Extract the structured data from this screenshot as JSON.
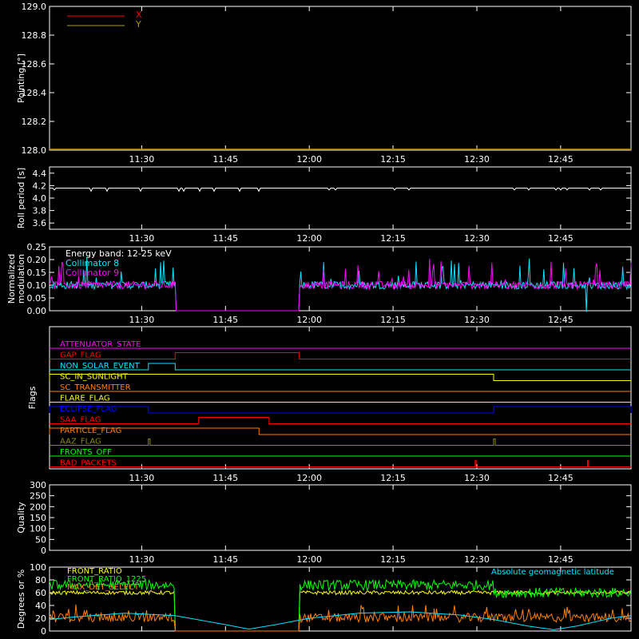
{
  "time_axis": {
    "ticks": [
      "11:30",
      "11:45",
      "12:00",
      "12:15",
      "12:30",
      "12:45"
    ],
    "tick_hours": [
      11.5,
      11.75,
      12.0,
      12.25,
      12.5,
      12.75
    ],
    "range": [
      11.225,
      12.96
    ]
  },
  "chart_data": [
    {
      "type": "line",
      "panel": "pointing",
      "ylabel": "Pointing [°]",
      "ylim": [
        128.0,
        129.0
      ],
      "yticks": [
        "128.0",
        "128.2",
        "128.4",
        "128.6",
        "128.8",
        "129.0"
      ],
      "yticks_val": [
        128.0,
        128.2,
        128.4,
        128.6,
        128.8,
        129.0
      ],
      "legend_position": "top-left",
      "series": [
        {
          "name": "X",
          "color": "#ff0000",
          "x": [
            11.225,
            12.96
          ],
          "y": [
            128.0,
            128.0
          ]
        },
        {
          "name": "Y",
          "color": "#b09a00",
          "x": [
            11.225,
            12.96
          ],
          "y": [
            128.0,
            128.0
          ]
        }
      ]
    },
    {
      "type": "line",
      "panel": "roll",
      "ylabel": "Roll period [s]",
      "ylim": [
        3.5,
        4.5
      ],
      "yticks": [
        "3.6",
        "3.8",
        "4.0",
        "4.2",
        "4.4"
      ],
      "yticks_val": [
        3.6,
        3.8,
        4.0,
        4.2,
        4.4
      ],
      "series": [
        {
          "name": "Roll period",
          "color": "#ffffff",
          "x": [
            11.225,
            12.96
          ],
          "y": [
            4.16,
            4.16
          ]
        }
      ]
    },
    {
      "type": "line",
      "panel": "modulation",
      "ylabel": "Normalized modulation",
      "ylabel_lines": [
        "Normalized",
        "modulation"
      ],
      "ylim": [
        0.0,
        0.25
      ],
      "yticks": [
        "0.00",
        "0.05",
        "0.10",
        "0.15",
        "0.20",
        "0.25"
      ],
      "yticks_val": [
        0.0,
        0.05,
        0.1,
        0.15,
        0.2,
        0.25
      ],
      "legend_position": "top-left",
      "legend_title": "Energy band: 12-25 keV",
      "gap": [
        11.6,
        11.97
      ],
      "series": [
        {
          "name": "Collimator 8",
          "color": "#00e5ff",
          "baseline": 0.1
        },
        {
          "name": "Collimator 9",
          "color": "#ff00ff",
          "baseline": 0.1
        }
      ]
    },
    {
      "type": "line",
      "panel": "flags",
      "ylabel": "Flags",
      "flags": [
        {
          "name": "ATTENUATOR_STATE",
          "color": "#ff00ff",
          "high": []
        },
        {
          "name": "GAP_FLAG",
          "color": "#ff0000",
          "high": [
            [
              11.6,
              11.97
            ]
          ]
        },
        {
          "name": "NON_SOLAR_EVENT",
          "color": "#00e5ff",
          "high": [
            [
              11.52,
              11.6
            ]
          ]
        },
        {
          "name": "SC_IN_SUNLIGHT",
          "color": "#ffff00",
          "high": [
            [
              11.225,
              12.55
            ]
          ]
        },
        {
          "name": "SC_TRANSMITTER",
          "color": "#ff8000",
          "high": []
        },
        {
          "name": "FLARE_FLAG",
          "color": "#ffff00",
          "high": []
        },
        {
          "name": "ECLIPSE_FLAG",
          "color": "#0000ff",
          "high": [
            [
              11.225,
              11.52
            ],
            [
              12.55,
              12.96
            ]
          ]
        },
        {
          "name": "SAA_FLAG",
          "color": "#ff0000",
          "high": [
            [
              11.67,
              11.88
            ]
          ]
        },
        {
          "name": "PARTICLE_FLAG",
          "color": "#ff8000",
          "high": [
            [
              11.225,
              11.85
            ]
          ]
        },
        {
          "name": "AAZ_FLAG",
          "color": "#8a8a00",
          "high": [
            [
              11.52,
              11.525
            ],
            [
              12.55,
              12.555
            ]
          ]
        },
        {
          "name": "FRONTS_OFF",
          "color": "#00ff00",
          "high": []
        },
        {
          "name": "BAD_PACKETS",
          "color": "#ff0000",
          "high": [
            [
              12.495,
              12.498
            ],
            [
              12.83,
              12.833
            ]
          ]
        }
      ]
    },
    {
      "type": "line",
      "panel": "quality",
      "ylabel": "Quality",
      "ylim": [
        0,
        300
      ],
      "yticks": [
        "0",
        "50",
        "100",
        "150",
        "200",
        "250",
        "300"
      ],
      "yticks_val": [
        0,
        50,
        100,
        150,
        200,
        250,
        300
      ],
      "series": []
    },
    {
      "type": "line",
      "panel": "fronts",
      "ylabel": "Degrees or %",
      "ylim": [
        0,
        100
      ],
      "yticks": [
        "0",
        "20",
        "40",
        "60",
        "80",
        "100"
      ],
      "yticks_val": [
        0,
        20,
        40,
        60,
        80,
        100
      ],
      "legend_position": "top-left",
      "annotation": "Absolute geomagnetic latitude",
      "gap": [
        11.6,
        11.97
      ],
      "series": [
        {
          "name": "FRONT_RATIO",
          "color": "#ffff00",
          "baseline": 60
        },
        {
          "name": "FRONT_RATIO_1225",
          "color": "#00ff00",
          "baseline": 72
        },
        {
          "name": "MAX_DET_SELECT",
          "color": "#ff8000",
          "baseline": 18
        },
        {
          "name": "Absolute geomagnetic latitude",
          "color": "#00e5ff",
          "x": [
            11.225,
            11.3,
            11.45,
            11.6,
            11.75,
            11.82,
            11.9,
            12.0,
            12.15,
            12.3,
            12.45,
            12.55,
            12.65,
            12.73,
            12.8,
            12.9,
            12.96
          ],
          "y": [
            18,
            22,
            28,
            24,
            10,
            3,
            10,
            20,
            28,
            30,
            25,
            18,
            8,
            2,
            8,
            20,
            24
          ]
        }
      ]
    }
  ]
}
